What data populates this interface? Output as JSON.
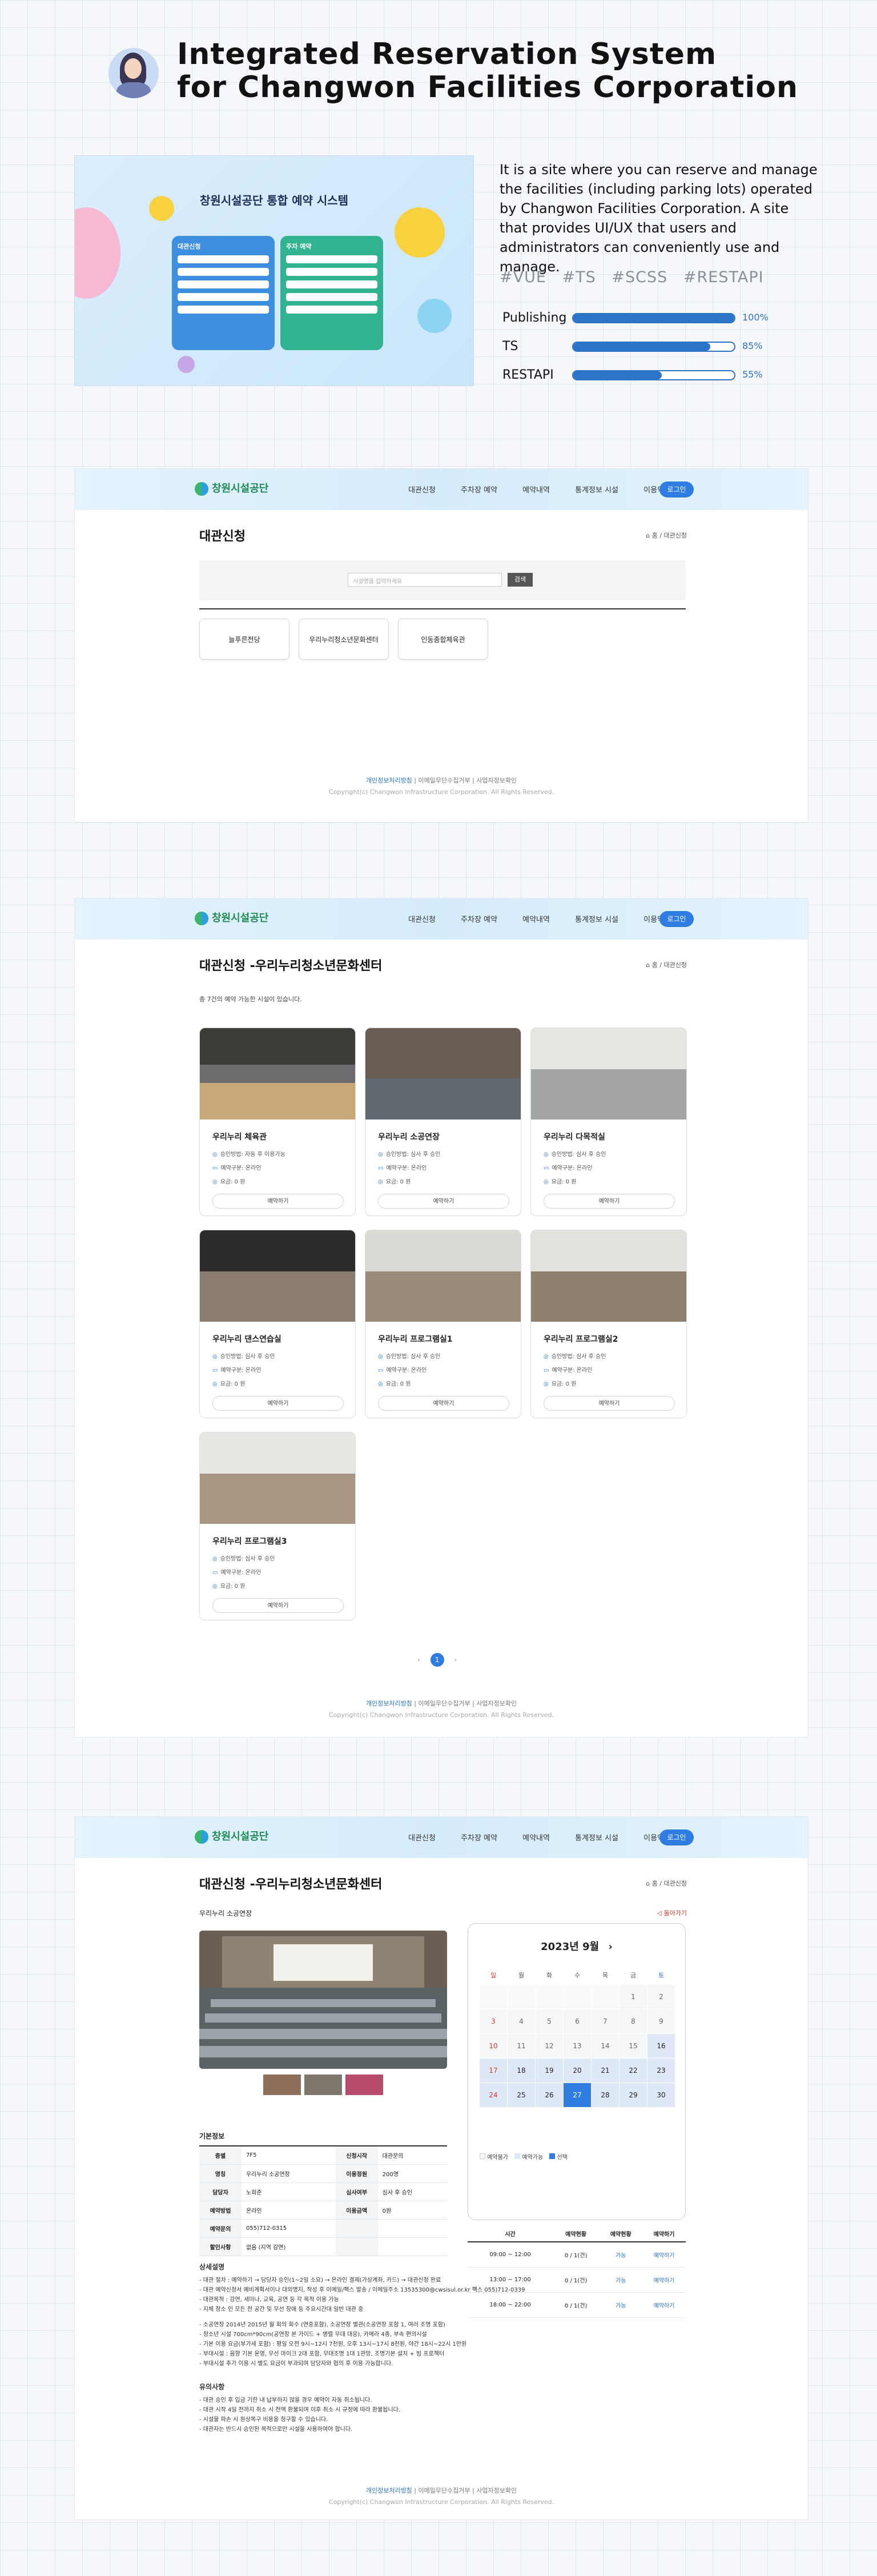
{
  "hero": {
    "title_line1": "Integrated Reservation System",
    "title_line2": "for Changwon Facilities Corporation",
    "description": "It is a site where you can reserve and manage the facilities (including parking lots) operated by Changwon Facilities Corporation. A site that provides UI/UX that users and administrators can conveniently use and manage.",
    "tags": [
      "#VUE",
      "#TS",
      "#SCSS",
      "#RESTAPI"
    ],
    "skills": [
      {
        "label": "Publishing",
        "percent": 100,
        "percent_text": "100%"
      },
      {
        "label": "TS",
        "percent": 85,
        "percent_text": "85%"
      },
      {
        "label": "RESTAPI",
        "percent": 55,
        "percent_text": "55%"
      }
    ],
    "thumb_title": "창원시설공단 통합 예약 시스템",
    "thumb_left_panel": "대관신청",
    "thumb_right_panel": "주차 예약"
  },
  "nav": {
    "logo": "창원시설공단",
    "menu": [
      "대관신청",
      "주차장 예약",
      "예약내역",
      "통계정보 시설",
      "이용약관"
    ],
    "login": "로그인"
  },
  "footer": {
    "links": [
      "개인정보처리방침",
      "이메일무단수집거부",
      "사업자정보확인"
    ],
    "copyright": "Copyright(c) Changwon Infrastructure Corporation. All Rights Reserved."
  },
  "page1": {
    "title": "대관신청",
    "crumb": "⌂ 홈 / 대관신청",
    "search_placeholder": "시설명을 입력하세요",
    "search_button": "검색",
    "facilities": [
      "늘푸른전당",
      "우리누리청소년문화센터",
      "인동종합체육관"
    ]
  },
  "page2": {
    "title": "대관신청 -우리누리청소년문화센터",
    "crumb": "⌂ 홈 / 대관신청",
    "count_text": "총 7건의 예약 가능한 시설이 있습니다.",
    "cards": [
      {
        "name": "우리누리 체육관",
        "r1": "승인방법: 자동 후 이용가능",
        "r2": "예약구분: 온라인",
        "r3": "요금: 0 원",
        "btn": "예약하기"
      },
      {
        "name": "우리누리 소공연장",
        "r1": "승인방법: 심사 후 승인",
        "r2": "예약구분: 온라인",
        "r3": "요금: 0 원",
        "btn": "예약하기"
      },
      {
        "name": "우리누리 다목적실",
        "r1": "승인방법: 심사 후 승인",
        "r2": "예약구분: 온라인",
        "r3": "요금: 0 원",
        "btn": "예약하기"
      },
      {
        "name": "우리누리 댄스연습실",
        "r1": "승인방법: 심사 후 승인",
        "r2": "예약구분: 온라인",
        "r3": "요금: 0 원",
        "btn": "예약하기"
      },
      {
        "name": "우리누리 프로그램실1",
        "r1": "승인방법: 심사 후 승인",
        "r2": "예약구분: 온라인",
        "r3": "요금: 0 원",
        "btn": "예약하기"
      },
      {
        "name": "우리누리 프로그램실2",
        "r1": "승인방법: 심사 후 승인",
        "r2": "예약구분: 온라인",
        "r3": "요금: 0 원",
        "btn": "예약하기"
      },
      {
        "name": "우리누리 프로그램실3",
        "r1": "승인방법: 심사 후 승인",
        "r2": "예약구분: 온라인",
        "r3": "요금: 0 원",
        "btn": "예약하기"
      }
    ],
    "pager": {
      "prev": "‹",
      "current": "1",
      "next": "›"
    }
  },
  "page3": {
    "title": "대관신청 -우리누리청소년문화센터",
    "crumb": "⌂ 홈 / 대관신청",
    "subtitle": "우리누리 소공연장",
    "back": "◁ 돌아가기",
    "info_heading": "기본정보",
    "info": [
      [
        "층별",
        "7F5",
        "신청시작",
        "대관문의"
      ],
      [
        "명칭",
        "우리누리 소공연장",
        "이용정원",
        "200명"
      ],
      [
        "담당자",
        "노희준",
        "심사여부",
        "심사 후 승인"
      ],
      [
        "예약방법",
        "온라인",
        "이용금액",
        "0원"
      ],
      [
        "예약문의",
        "055)712-0315",
        "",
        ""
      ],
      [
        "할인사항",
        "없음 (지역 감면)",
        "",
        ""
      ]
    ],
    "calendar": {
      "title": "2023년 9월",
      "weekdays": [
        "일",
        "월",
        "화",
        "수",
        "목",
        "금",
        "토"
      ],
      "days": [
        "",
        "",
        "",
        "",
        "",
        "1",
        "2",
        "3",
        "4",
        "5",
        "6",
        "7",
        "8",
        "9",
        "10",
        "11",
        "12",
        "13",
        "14",
        "15",
        "16",
        "17",
        "18",
        "19",
        "20",
        "21",
        "22",
        "23",
        "24",
        "25",
        "26",
        "27",
        "28",
        "29",
        "30"
      ],
      "selected": "27",
      "legend": [
        "예약불가",
        "예약가능",
        "선택"
      ]
    },
    "slots_header": [
      "시간",
      "예약현황",
      "예약현황",
      "예약하기"
    ],
    "slots": [
      [
        "09:00 ~ 12:00",
        "0 / 1(건)",
        "가능",
        "예약하기"
      ],
      [
        "13:00 ~ 17:00",
        "0 / 1(건)",
        "가능",
        "예약하기"
      ],
      [
        "18:00 ~ 22:00",
        "0 / 1(건)",
        "가능",
        "예약하기"
      ]
    ],
    "notes1_heading": "상세설명",
    "notes1": [
      "- 대관 절차 : 예약하기 → 담당자 승인(1~2일 소요) → 온라인 결제(가상계좌, 카드) → 대관신청 완료",
      "- 대관 예약신청서 예비계획서이나 대외명지, 작성 후 이메일/팩스 발송 / 이메일주소 13535300@cwsisul.or.kr   팩스 055)712-0339",
      "- 대관목적 : 강연, 세미나, 교육, 공연 등 각 목적 이용 가능",
      "- 지체 장소 인 모든 전 공간 및 무선 장애 등 주요시간대 일반 대관 중",
      "",
      "- 소공연장 2014년 2015년 월 회의 회수 (연중포함), 소공연장 별관(소공연장 포함 1, 여러 조명 포함)",
      "- 청소년 시설 700cm*90cm(공연장 본 가이드 + 병렬 무대 대응), 카메라 4종, 부속 편의시설",
      "- 기본 이용 요금(부가세 포함) : 평일 오전 9시~12시 7천원, 오후 13시~17시 8천원, 야간 18시~22시 1만원",
      "- 부대시설 : 음향 기본 운영, 무선 마이크 2대 포함, 무대조명 1대 1관망, 조명기본 설치 + 빔 프로젝터",
      "- 부대시설 추가 이용 시 별도 요금이 부과되며 담당자와 협의 후 이용 가능합니다."
    ],
    "notes2_heading": "유의사항",
    "notes2": [
      "- 대관 승인 후 입금 기한 내 납부하지 않을 경우 예약이 자동 취소됩니다.",
      "- 대관 시작 4일 전까지 취소 시 전액 환불되며 이후 취소 시 규정에 따라 환불됩니다.",
      "- 시설물 파손 시 원상복구 비용을 청구할 수 있습니다.",
      "- 대관자는 반드시 승인된 목적으로만 시설을 사용하여야 합니다."
    ]
  },
  "colors": {
    "accent": "#2f7de0",
    "skill_bar": "#2b74c7",
    "nav_bg": "#dcf0fc"
  }
}
